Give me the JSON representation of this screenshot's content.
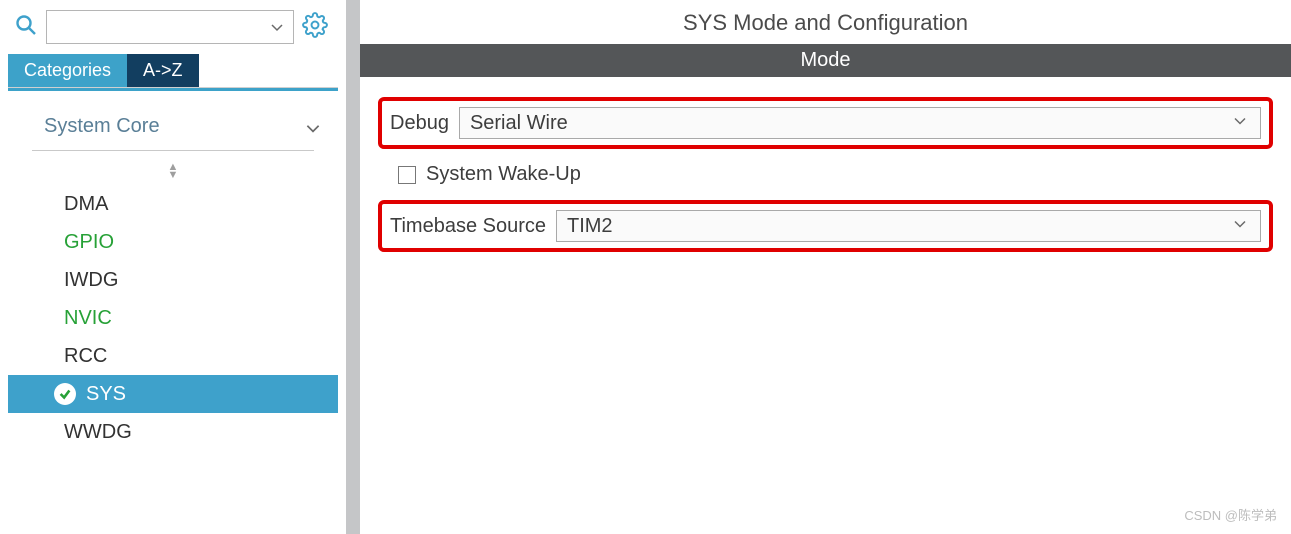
{
  "sidebar": {
    "search": {
      "placeholder": ""
    },
    "tabs": {
      "categories": "Categories",
      "az": "A->Z"
    },
    "category": {
      "name": "System Core"
    },
    "items": [
      {
        "label": "DMA",
        "configured": false,
        "selected": false
      },
      {
        "label": "GPIO",
        "configured": true,
        "selected": false
      },
      {
        "label": "IWDG",
        "configured": false,
        "selected": false
      },
      {
        "label": "NVIC",
        "configured": true,
        "selected": false
      },
      {
        "label": "RCC",
        "configured": false,
        "selected": false
      },
      {
        "label": "SYS",
        "configured": true,
        "selected": true
      },
      {
        "label": "WWDG",
        "configured": false,
        "selected": false
      }
    ]
  },
  "main": {
    "title": "SYS Mode and Configuration",
    "section": "Mode",
    "debug": {
      "label": "Debug",
      "value": "Serial Wire"
    },
    "wakeup": {
      "label": "System Wake-Up",
      "checked": false
    },
    "timebase": {
      "label": "Timebase Source",
      "value": "TIM2"
    }
  },
  "watermark": "CSDN @陈学弟"
}
